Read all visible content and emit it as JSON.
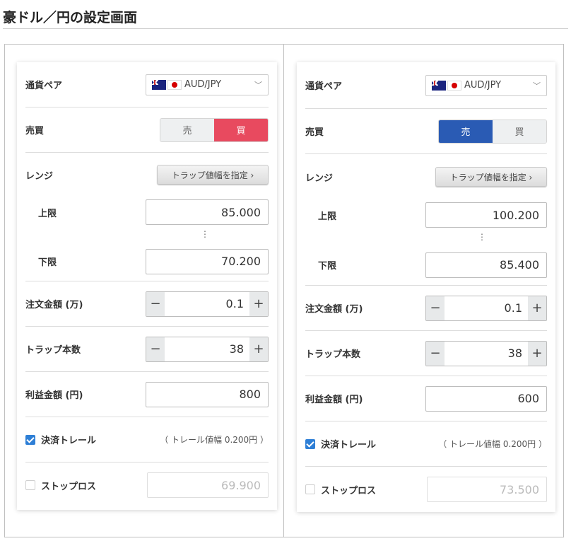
{
  "title": "豪ドル／円の設定画面",
  "labels": {
    "currency_pair": "通貨ペア",
    "side": "売買",
    "range": "レンジ",
    "upper": "上限",
    "lower": "下限",
    "order_amount": "注文金額 (万)",
    "trap_count": "トラップ本数",
    "profit": "利益金額 (円)",
    "trail": "決済トレール",
    "stoploss": "ストップロス",
    "sell": "売",
    "buy": "買",
    "trap_width_btn": "トラップ値幅を指定 ›",
    "minus": "−",
    "plus": "+",
    "chevron": "﹀",
    "range_dots": "⋮"
  },
  "panels": [
    {
      "pair": "AUD/JPY",
      "side_active": "buy",
      "upper": "85.000",
      "lower": "70.200",
      "order_amount": "0.1",
      "trap_count": "38",
      "profit": "800",
      "trail_checked": true,
      "trail_note": "（ トレール値幅 0.200円 ）",
      "stoploss_checked": false,
      "stoploss_value": "69.900"
    },
    {
      "pair": "AUD/JPY",
      "side_active": "sell",
      "upper": "100.200",
      "lower": "85.400",
      "order_amount": "0.1",
      "trap_count": "38",
      "profit": "600",
      "trail_checked": true,
      "trail_note": "（ トレール値幅 0.200円 ）",
      "stoploss_checked": false,
      "stoploss_value": "73.500"
    }
  ],
  "colors": {
    "sell_active": "#2a5bb4",
    "buy_active": "#e84a5f",
    "checkbox": "#2e7fd6"
  }
}
